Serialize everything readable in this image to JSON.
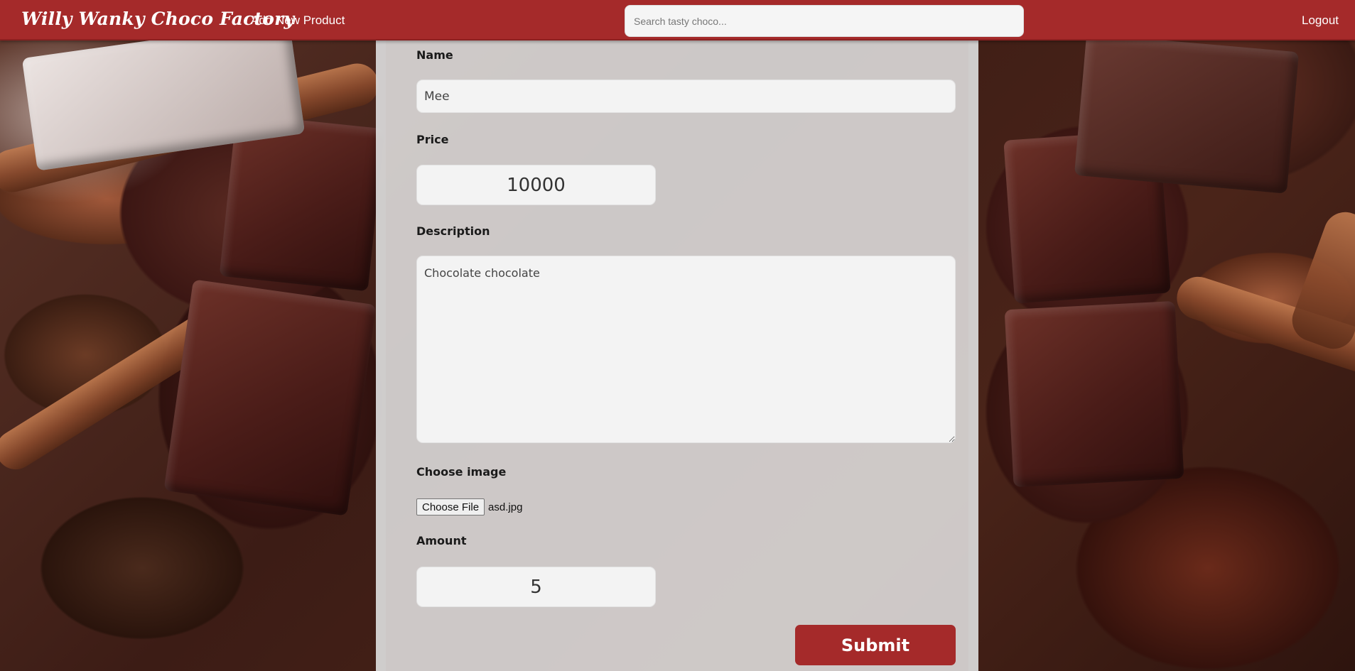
{
  "navbar": {
    "brand": "Willy Wanky Choco Factory",
    "add_product": "Add New Product",
    "search_placeholder": "Search tasty choco...",
    "logout": "Logout"
  },
  "form": {
    "name_label": "Name",
    "name_value": "Mee",
    "price_label": "Price",
    "price_value": "10000",
    "description_label": "Description",
    "description_value": "Chocolate chocolate",
    "image_label": "Choose image",
    "file_button": "Choose File",
    "file_name": "asd.jpg",
    "amount_label": "Amount",
    "amount_value": "5",
    "submit": "Submit"
  },
  "colors": {
    "brand_red": "#a52a2a",
    "panel": "#e4e4e4"
  }
}
